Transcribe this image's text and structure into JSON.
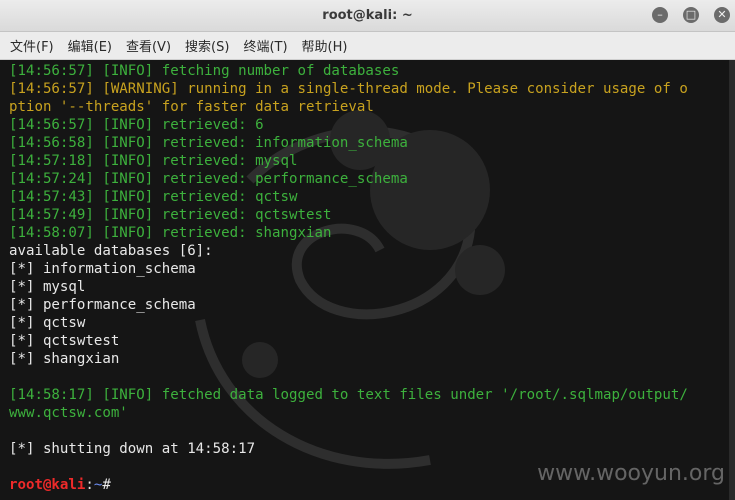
{
  "window": {
    "title": "root@kali: ~",
    "minimize_icon": "minimize-icon",
    "maximize_icon": "maximize-icon",
    "close_icon": "close-icon"
  },
  "menu": [
    "文件(F)",
    "编辑(E)",
    "查看(V)",
    "搜索(S)",
    "终端(T)",
    "帮助(H)"
  ],
  "terminal": {
    "lines": [
      {
        "segments": [
          {
            "text": "[14:56:57] [INFO] fetching number of databases",
            "color": "#3db13d"
          }
        ]
      },
      {
        "segments": [
          {
            "text": "[14:56:57] [WARNING] running in a single-thread mode. Please consider usage of o",
            "color": "#c8a21f"
          }
        ]
      },
      {
        "segments": [
          {
            "text": "ption '--threads' for faster data retrieval",
            "color": "#c8a21f"
          }
        ]
      },
      {
        "segments": [
          {
            "text": "[14:56:57] [INFO] retrieved: 6",
            "color": "#3db13d"
          }
        ]
      },
      {
        "segments": [
          {
            "text": "[14:56:58] [INFO] retrieved: information_schema",
            "color": "#3db13d"
          }
        ]
      },
      {
        "segments": [
          {
            "text": "[14:57:18] [INFO] retrieved: mysql",
            "color": "#3db13d"
          }
        ]
      },
      {
        "segments": [
          {
            "text": "[14:57:24] [INFO] retrieved: performance_schema",
            "color": "#3db13d"
          }
        ]
      },
      {
        "segments": [
          {
            "text": "[14:57:43] [INFO] retrieved: qctsw",
            "color": "#3db13d"
          }
        ]
      },
      {
        "segments": [
          {
            "text": "[14:57:49] [INFO] retrieved: qctswtest",
            "color": "#3db13d"
          }
        ]
      },
      {
        "segments": [
          {
            "text": "[14:58:07] [INFO] retrieved: shangxian",
            "color": "#3db13d"
          }
        ]
      },
      {
        "segments": [
          {
            "text": "available databases [6]:",
            "color": "#e8e8e8"
          }
        ]
      },
      {
        "segments": [
          {
            "text": "[*] information_schema",
            "color": "#e8e8e8"
          }
        ]
      },
      {
        "segments": [
          {
            "text": "[*] mysql",
            "color": "#e8e8e8"
          }
        ]
      },
      {
        "segments": [
          {
            "text": "[*] performance_schema",
            "color": "#e8e8e8"
          }
        ]
      },
      {
        "segments": [
          {
            "text": "[*] qctsw",
            "color": "#e8e8e8"
          }
        ]
      },
      {
        "segments": [
          {
            "text": "[*] qctswtest",
            "color": "#e8e8e8"
          }
        ]
      },
      {
        "segments": [
          {
            "text": "[*] shangxian",
            "color": "#e8e8e8"
          }
        ]
      },
      {
        "segments": [
          {
            "text": "",
            "color": "#e8e8e8"
          }
        ]
      },
      {
        "segments": [
          {
            "text": "[14:58:17] [INFO] fetched data logged to text files under '/root/.sqlmap/output/",
            "color": "#3db13d"
          }
        ]
      },
      {
        "segments": [
          {
            "text": "www.qctsw.com'",
            "color": "#3db13d"
          }
        ]
      },
      {
        "segments": [
          {
            "text": "",
            "color": "#e8e8e8"
          }
        ]
      },
      {
        "segments": [
          {
            "text": "[*] shutting down at 14:58:17",
            "color": "#e8e8e8"
          }
        ]
      },
      {
        "segments": [
          {
            "text": "",
            "color": "#e8e8e8"
          }
        ]
      },
      {
        "segments": [
          {
            "text": "root@kali",
            "color": "#ee2a2a",
            "bold": true
          },
          {
            "text": ":",
            "color": "#e8e8e8"
          },
          {
            "text": "~",
            "color": "#6b8cf0"
          },
          {
            "text": "#",
            "color": "#e8e8e8"
          }
        ]
      }
    ]
  },
  "watermark": "www.wooyun.org"
}
